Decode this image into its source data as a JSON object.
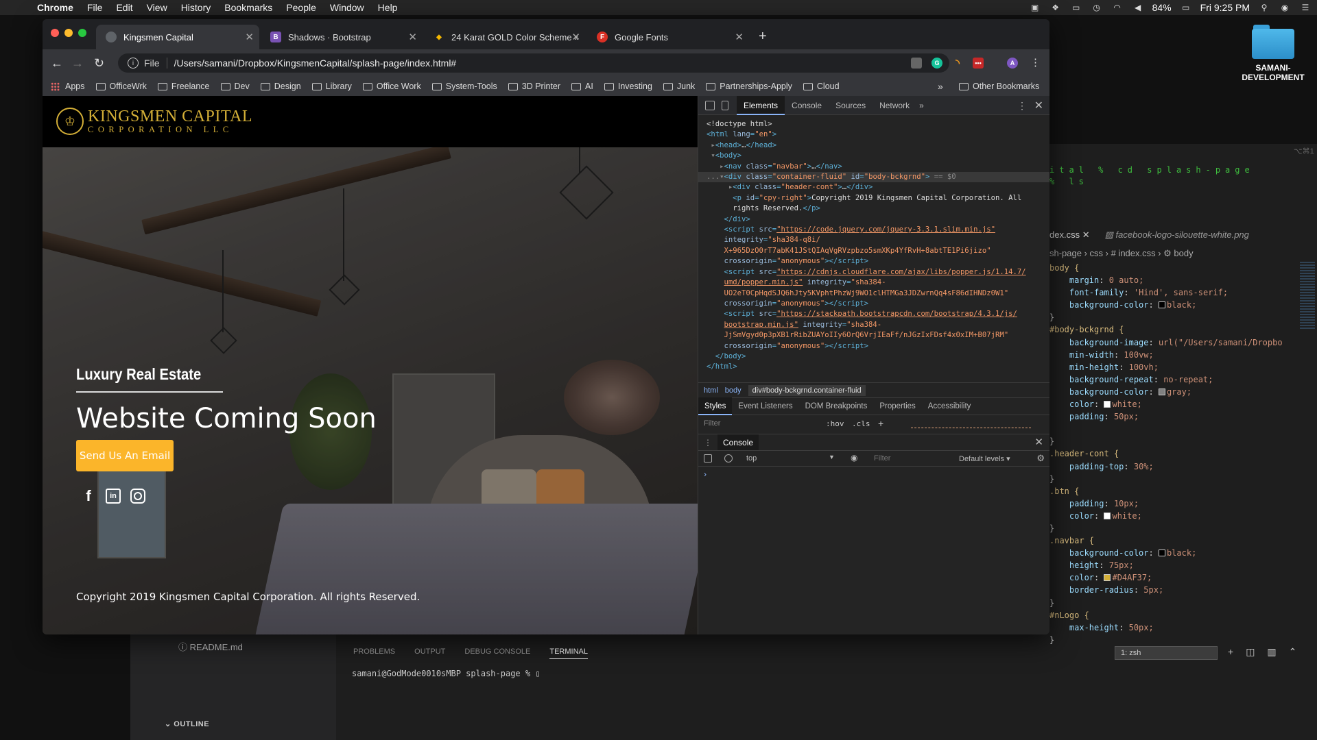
{
  "menubar": {
    "app": "Chrome",
    "items": [
      "File",
      "Edit",
      "View",
      "History",
      "Bookmarks",
      "People",
      "Window",
      "Help"
    ],
    "battery": "84%",
    "clock": "Fri 9:25 PM"
  },
  "desktop": {
    "folder_label_1": "SAMANI-",
    "folder_label_2": "DEVELOPMENT"
  },
  "vscode": {
    "readme": "README.md",
    "outline": "OUTLINE",
    "terminal_tabs": [
      "PROBLEMS",
      "OUTPUT",
      "DEBUG CONSOLE",
      "TERMINAL"
    ],
    "terminal_line": "samani@GodMode0010sMBP splash-page % ",
    "terminal_select": "1: zsh",
    "mini_term_1": "ital % cd splash-page",
    "mini_term_2": "% ls",
    "shortcut": "⌥⌘1",
    "editor_tab_active": "dex.css",
    "editor_tab_inactive": "facebook-logo-silouette-white.png",
    "breadcrumb": "sh-page › css › # index.css › ⚙ body",
    "code_lines": [
      {
        "t": "sel",
        "s": "body {"
      },
      {
        "t": "decl",
        "p": "margin",
        "v": "0 auto;"
      },
      {
        "t": "decl",
        "p": "font-family",
        "v": "'Hind', sans-serif;"
      },
      {
        "t": "decl",
        "p": "background-color",
        "v": "black;",
        "sw": "#000000"
      },
      {
        "t": "plain",
        "s": "}"
      },
      {
        "t": "sel",
        "s": "#body-bckgrnd {"
      },
      {
        "t": "decl",
        "p": "background-image",
        "v": "url(\"/Users/samani/Dropbo"
      },
      {
        "t": "decl",
        "p": "min-width",
        "v": "100vw;"
      },
      {
        "t": "decl",
        "p": "min-height",
        "v": "100vh;"
      },
      {
        "t": "decl",
        "p": "background-repeat",
        "v": "no-repeat;"
      },
      {
        "t": "decl",
        "p": "background-color",
        "v": "gray;",
        "sw": "#808080"
      },
      {
        "t": "decl",
        "p": "color",
        "v": "white;",
        "sw": "#ffffff"
      },
      {
        "t": "decl",
        "p": "padding",
        "v": "50px;"
      },
      {
        "t": "plain",
        "s": ""
      },
      {
        "t": "plain",
        "s": "}"
      },
      {
        "t": "sel",
        "s": ".header-cont {"
      },
      {
        "t": "decl",
        "p": "padding-top",
        "v": "30%;"
      },
      {
        "t": "plain",
        "s": "}"
      },
      {
        "t": "sel",
        "s": ".btn {"
      },
      {
        "t": "decl",
        "p": "padding",
        "v": "10px;"
      },
      {
        "t": "decl",
        "p": "color",
        "v": "white;",
        "sw": "#ffffff"
      },
      {
        "t": "plain",
        "s": "}"
      },
      {
        "t": "sel",
        "s": ".navbar {"
      },
      {
        "t": "decl",
        "p": "background-color",
        "v": "black;",
        "sw": "#000000"
      },
      {
        "t": "decl",
        "p": "height",
        "v": "75px;"
      },
      {
        "t": "decl",
        "p": "color",
        "v": "#D4AF37;",
        "sw": "#D4AF37"
      },
      {
        "t": "decl",
        "p": "border-radius",
        "v": "5px;"
      },
      {
        "t": "plain",
        "s": "}"
      },
      {
        "t": "sel",
        "s": "#nLogo {"
      },
      {
        "t": "decl",
        "p": "max-height",
        "v": "50px;"
      },
      {
        "t": "plain",
        "s": "}"
      }
    ]
  },
  "chrome": {
    "tabs": [
      {
        "label": "Kingsmen Capital",
        "fav": "",
        "fav_color": "#5f6368"
      },
      {
        "label": "Shadows · Bootstrap",
        "fav": "B",
        "fav_color": "#7952b3"
      },
      {
        "label": "24 Karat GOLD Color Scheme »",
        "fav": "◆",
        "fav_color": "#333333"
      },
      {
        "label": "Google Fonts",
        "fav": "F",
        "fav_color": "#d93025"
      }
    ],
    "url_scheme": "File",
    "url": "/Users/samani/Dropbox/KingsmenCapital/splash-page/index.html#",
    "profile_initial": "A",
    "bookmarks": [
      "OfficeWrk",
      "Freelance",
      "Dev",
      "Design",
      "Library",
      "Office Work",
      "System-Tools",
      "3D Printer",
      "AI",
      "Investing",
      "Junk",
      "Partnerships-Apply",
      "Cloud"
    ],
    "apps_label": "Apps",
    "other_bookmarks": "Other Bookmarks"
  },
  "site": {
    "logo_line1": "KINGSMEN CAPITAL",
    "logo_line2": "CORPORATION LLC",
    "tagline": "Luxury Real Estate",
    "title": "Website Coming Soon",
    "button": "Send Us An Email",
    "social_fb": "f",
    "social_li": "in",
    "copyright": "Copyright 2019 Kingsmen Capital Corporation. All rights Reserved.",
    "accent": "#D4AF37",
    "button_color": "#fbb52a"
  },
  "devtools": {
    "tabs": [
      "Elements",
      "Console",
      "Sources",
      "Network"
    ],
    "crumbs": [
      "html",
      "body",
      "div#body-bckgrnd.container-fluid"
    ],
    "subtabs": [
      "Styles",
      "Event Listeners",
      "DOM Breakpoints",
      "Properties",
      "Accessibility"
    ],
    "filter_placeholder": "Filter",
    "hov": ":hov",
    "cls": ".cls",
    "drawer_tab": "Console",
    "context": "top",
    "console_filter": "Filter",
    "levels": "Default levels ▾",
    "prompt": "›"
  }
}
